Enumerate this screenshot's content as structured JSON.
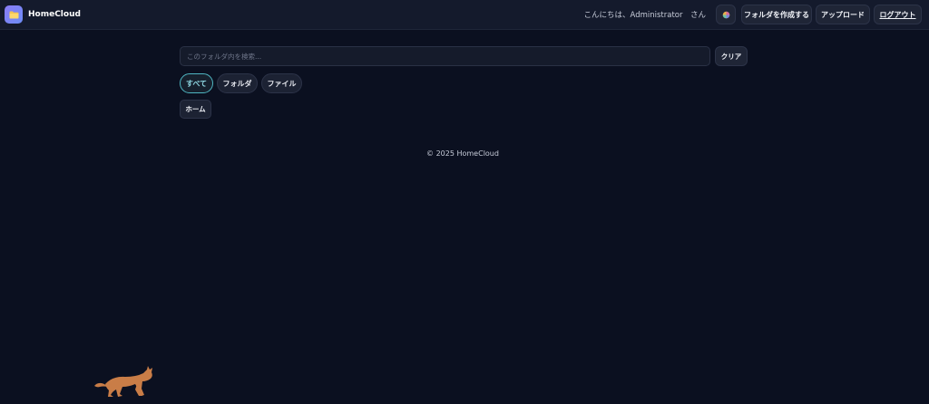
{
  "app": {
    "name": "HomeCloud"
  },
  "header": {
    "greeting": "こんにちは、Administrator　さん",
    "create_folder_label": "フォルダを作成する",
    "upload_label": "アップロード",
    "logout_label": "ログアウト"
  },
  "search": {
    "placeholder": "このフォルダ内を検索...",
    "value": "",
    "clear_label": "クリア"
  },
  "filters": {
    "items": [
      {
        "label": "すべて",
        "active": true
      },
      {
        "label": "フォルダ",
        "active": false
      },
      {
        "label": "ファイル",
        "active": false
      }
    ]
  },
  "breadcrumb": {
    "home_label": "ホーム"
  },
  "footer": {
    "text": "© 2025 HomeCloud"
  },
  "icons": {
    "logo": "folder-icon",
    "theme": "palette-icon",
    "mascot": "cat-icon"
  },
  "colors": {
    "background": "#0b1020",
    "topbar": "#141a2c",
    "accent": "#4fb6c2",
    "logo_gradient_start": "#8b7cf6",
    "logo_gradient_end": "#6c8cf5",
    "mascot": "#c97d47"
  }
}
